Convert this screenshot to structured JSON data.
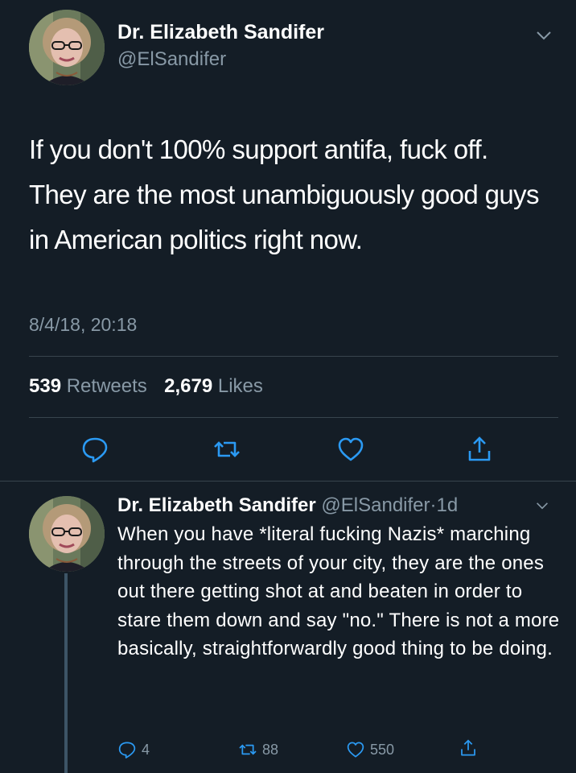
{
  "tweet": {
    "author_name": "Dr. Elizabeth Sandifer",
    "handle": "@ElSandifer",
    "text": "If you don't 100% support antifa, fuck off. They are the most unambiguously good guys in American politics right now.",
    "timestamp": "8/4/18, 20:18",
    "retweets_count": "539",
    "retweets_label": "Retweets",
    "likes_count": "2,679",
    "likes_label": "Likes"
  },
  "reply": {
    "author_name": "Dr. Elizabeth Sandifer",
    "handle": "@ElSandifer",
    "time_sep": "·",
    "time": "1d",
    "text": "When you have *literal fucking Nazis* marching through the streets of your city, they are the ones out there getting shot at and beaten in order to stare them down and say \"no.\" There is not a more basically, straightforwardly good thing to be doing.",
    "reply_count": "4",
    "retweet_count": "88",
    "like_count": "550"
  },
  "colors": {
    "background": "#141d26",
    "text": "#ffffff",
    "secondary": "#8899a6",
    "divider": "#38444d",
    "icon": "#2b9af3"
  },
  "icons": [
    "chevron-down-icon",
    "reply-icon",
    "retweet-icon",
    "like-icon",
    "share-icon"
  ]
}
